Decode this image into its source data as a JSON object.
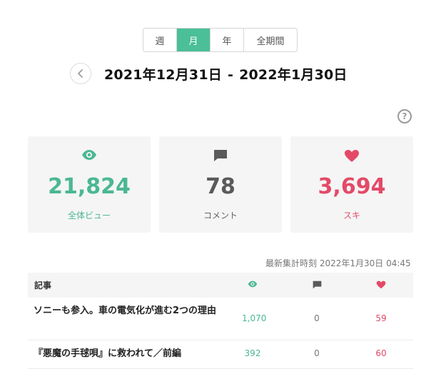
{
  "period_tabs": [
    {
      "label": "週",
      "active": false
    },
    {
      "label": "月",
      "active": true
    },
    {
      "label": "年",
      "active": false
    },
    {
      "label": "全期間",
      "active": false
    }
  ],
  "date_range": {
    "start": "2021年12月31日",
    "separator": "-",
    "end": "2022年1月30日"
  },
  "help_icon": "question-circle-icon",
  "summary": {
    "views": {
      "value": "21,824",
      "label": "全体ビュー",
      "icon": "eye-icon",
      "color": "#4bb893"
    },
    "comments": {
      "value": "78",
      "label": "コメント",
      "icon": "comment-icon",
      "color": "#5a5a5a"
    },
    "likes": {
      "value": "3,694",
      "label": "スキ",
      "icon": "heart-icon",
      "color": "#e34a67"
    }
  },
  "updated_at": "最新集計時刻 2022年1月30日 04:45",
  "table": {
    "header": {
      "title": "記事",
      "views_icon": "eye-icon",
      "comments_icon": "comment-icon",
      "likes_icon": "heart-icon"
    },
    "rows": [
      {
        "title": "ソニーも参入。車の電気化が進む2つの理由",
        "views": "1,070",
        "comments": "0",
        "likes": "59"
      },
      {
        "title": "『悪魔の手毬唄』に救われて／前編",
        "views": "392",
        "comments": "0",
        "likes": "60"
      }
    ]
  }
}
